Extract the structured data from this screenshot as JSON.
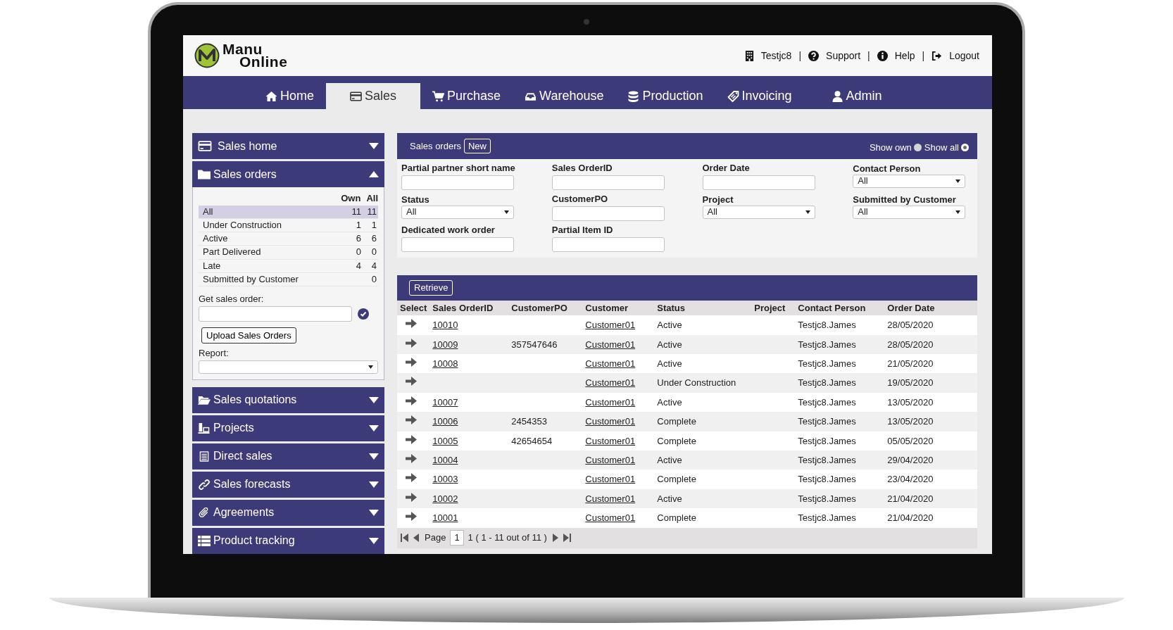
{
  "header": {
    "logo": {
      "line_1": "Manu",
      "line_2": "Online"
    },
    "user_links": [
      {
        "label": "Testjc8",
        "separator_after": "|"
      },
      {
        "label": "Support",
        "separator_after": "|"
      },
      {
        "label": "Help",
        "separator_after": "|"
      },
      {
        "label": "Logout"
      }
    ]
  },
  "nav_tabs": [
    {
      "label": "Home",
      "selected": false
    },
    {
      "label": "Sales",
      "selected": true
    },
    {
      "label": "Purchase",
      "selected": false
    },
    {
      "label": "Warehouse",
      "selected": false
    },
    {
      "label": "Production",
      "selected": false
    },
    {
      "label": "Invoicing",
      "selected": false
    },
    {
      "label": "Admin",
      "selected": false
    }
  ],
  "sidebar": {
    "sections": [
      {
        "title": "Sales home",
        "expanded": false
      },
      {
        "title": "Sales orders",
        "expanded": true
      },
      {
        "title": "Sales quotations",
        "expanded": false
      },
      {
        "title": "Projects",
        "expanded": false
      },
      {
        "title": "Direct sales",
        "expanded": false
      },
      {
        "title": "Sales forecasts",
        "expanded": false
      },
      {
        "title": "Agreements",
        "expanded": false
      },
      {
        "title": "Product tracking",
        "expanded": false
      }
    ],
    "sales_orders_panel": {
      "columns": [
        "Own",
        "All"
      ],
      "rows": [
        {
          "label": "All",
          "own": "11",
          "all": "11",
          "selected": true
        },
        {
          "label": "Under Construction",
          "own": "1",
          "all": "1",
          "selected": false
        },
        {
          "label": "Active",
          "own": "6",
          "all": "6",
          "selected": false
        },
        {
          "label": "Part Delivered",
          "own": "0",
          "all": "0",
          "selected": false
        },
        {
          "label": "Late",
          "own": "4",
          "all": "4",
          "selected": false
        },
        {
          "label": "Submitted by Customer",
          "all": "0",
          "selected": false
        }
      ],
      "get_label": "Get sales order:",
      "upload_button": "Upload Sales Orders",
      "report_label": "Report:"
    }
  },
  "filter_panel": {
    "title": "Sales orders",
    "new_button": "New",
    "view_options": [
      {
        "label": "Show own",
        "selected": false
      },
      {
        "label": "Show all",
        "selected": true
      }
    ],
    "fields": [
      {
        "label": "Partial partner short name",
        "kind": "text"
      },
      {
        "label": "Sales OrderID",
        "kind": "text"
      },
      {
        "label": "Order Date",
        "kind": "text"
      },
      {
        "label": "Contact Person",
        "kind": "select",
        "value": "All"
      },
      {
        "label": "Status",
        "kind": "select",
        "value": "All"
      },
      {
        "label": "CustomerPO",
        "kind": "text"
      },
      {
        "label": "Project",
        "kind": "select",
        "value": "All"
      },
      {
        "label": "Submitted by Customer",
        "kind": "select",
        "value": "All"
      },
      {
        "label": "Dedicated work order",
        "kind": "text"
      },
      {
        "label": "Partial Item ID",
        "kind": "text"
      }
    ]
  },
  "results": {
    "retrieve_button": "Retrieve",
    "columns": [
      "Select",
      "Sales OrderID",
      "CustomerPO",
      "Customer",
      "Status",
      "Project",
      "Contact Person",
      "Order Date"
    ],
    "rows": [
      {
        "sales_order_id": "10010",
        "customer": "Customer01",
        "status": "Active",
        "contact_person": "Testjc8.James",
        "order_date": "28/05/2020"
      },
      {
        "sales_order_id": "10009",
        "customer_po": "357547646",
        "customer": "Customer01",
        "status": "Active",
        "contact_person": "Testjc8.James",
        "order_date": "28/05/2020"
      },
      {
        "sales_order_id": "10008",
        "customer": "Customer01",
        "status": "Active",
        "contact_person": "Testjc8.James",
        "order_date": "21/05/2020"
      },
      {
        "customer": "Customer01",
        "status": "Under Construction",
        "contact_person": "Testjc8.James",
        "order_date": "19/05/2020"
      },
      {
        "sales_order_id": "10007",
        "customer": "Customer01",
        "status": "Active",
        "contact_person": "Testjc8.James",
        "order_date": "13/05/2020"
      },
      {
        "sales_order_id": "10006",
        "customer_po": "2454353",
        "customer": "Customer01",
        "status": "Complete",
        "contact_person": "Testjc8.James",
        "order_date": "13/05/2020"
      },
      {
        "sales_order_id": "10005",
        "customer_po": "42654654",
        "customer": "Customer01",
        "status": "Complete",
        "contact_person": "Testjc8.James",
        "order_date": "05/05/2020"
      },
      {
        "sales_order_id": "10004",
        "customer": "Customer01",
        "status": "Active",
        "contact_person": "Testjc8.James",
        "order_date": "29/04/2020"
      },
      {
        "sales_order_id": "10003",
        "customer": "Customer01",
        "status": "Complete",
        "contact_person": "Testjc8.James",
        "order_date": "23/04/2020"
      },
      {
        "sales_order_id": "10002",
        "customer": "Customer01",
        "status": "Active",
        "contact_person": "Testjc8.James",
        "order_date": "21/04/2020"
      },
      {
        "sales_order_id": "10001",
        "customer": "Customer01",
        "status": "Complete",
        "contact_person": "Testjc8.James",
        "order_date": "21/04/2020"
      }
    ],
    "pagination": {
      "page_label": "Page",
      "page_value": "1",
      "summary": "1 ( 1 - 11 out of 11 )"
    }
  }
}
